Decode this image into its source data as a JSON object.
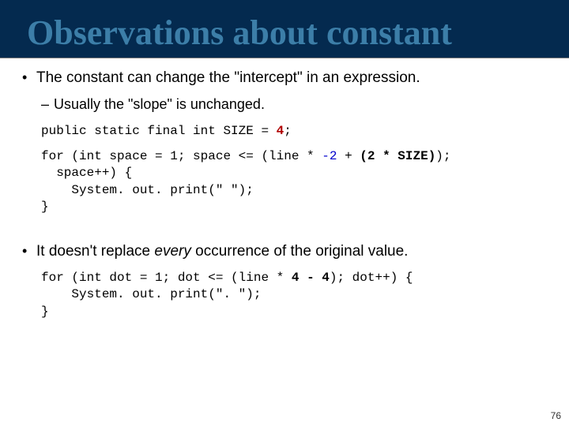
{
  "title": "Observations about constant",
  "bullet1": "The constant can change the \"intercept\" in an expression.",
  "sub1": "Usually the \"slope\" is unchanged.",
  "code1": {
    "l1a": "public static final int SIZE = ",
    "l1b": "4",
    "l1c": ";"
  },
  "code2": {
    "l1a": "for (int space = 1; space <= (line * ",
    "l1b": "-2",
    "l1c": " + ",
    "l1d": "(2 * SIZE)",
    "l1e": ");",
    "l2": "  space++) {",
    "l3": "    System. out. print(\" \");",
    "l4": "}"
  },
  "bullet2a": "It doesn't replace ",
  "bullet2b": "every",
  "bullet2c": " occurrence of the original value.",
  "code3": {
    "l1a": "for (int dot = 1; dot <= (line * ",
    "l1b": "4 - 4",
    "l1c": "); dot++) {",
    "l2": "    System. out. print(\". \");",
    "l3": "}"
  },
  "page": "76"
}
